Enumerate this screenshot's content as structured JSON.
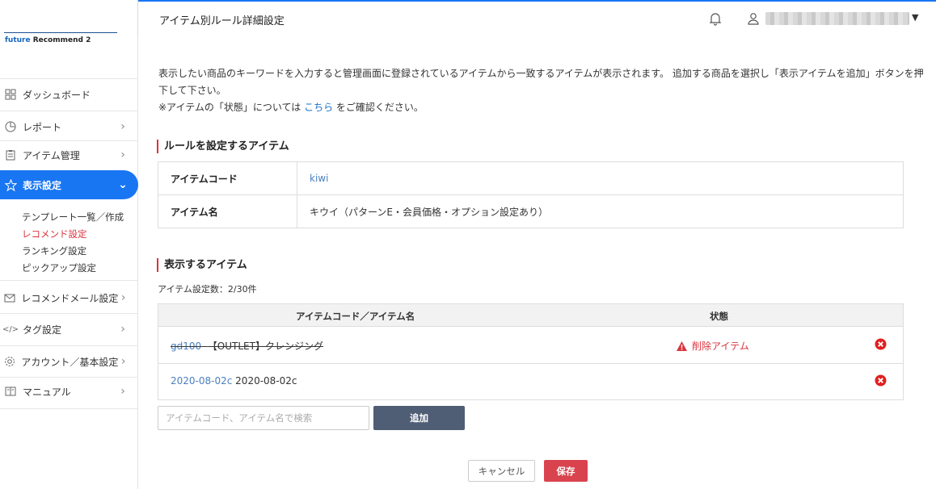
{
  "brand": {
    "future": "future",
    "rest": " Recommend 2"
  },
  "sidebar": {
    "items": [
      {
        "label": "ダッシュボード",
        "icon": "dashboard-icon"
      },
      {
        "label": "レポート",
        "icon": "chart-icon"
      },
      {
        "label": "アイテム管理",
        "icon": "clipboard-icon"
      },
      {
        "label": "表示設定",
        "icon": "star-icon"
      },
      {
        "label": "レコメンドメール設定",
        "icon": "mail-icon"
      },
      {
        "label": "タグ設定",
        "icon": "code-icon"
      },
      {
        "label": "アカウント／基本設定",
        "icon": "gear-icon"
      },
      {
        "label": "マニュアル",
        "icon": "book-icon"
      }
    ],
    "sub_items": [
      "テンプレート一覧／作成",
      "レコメンド設定",
      "ランキング設定",
      "ピックアップ設定"
    ]
  },
  "header": {
    "title": "アイテム別ルール詳細設定"
  },
  "main": {
    "desc_line1": "表示したい商品のキーワードを入力すると管理画面に登録されているアイテムから一致するアイテムが表示されます。 追加する商品を選択し「表示アイテムを追加」ボタンを押",
    "desc_line2": "下して下さい。",
    "note_prefix": "※アイテムの「状態」については ",
    "note_link": "こちら",
    "note_suffix": " をご確認ください。",
    "rule_section_title": "ルールを設定するアイテム",
    "rule_item": {
      "code_label": "アイテムコード",
      "code_value": "kiwi",
      "name_label": "アイテム名",
      "name_value": "キウイ（パターンE・会員価格・オプション設定あり）"
    },
    "display_section_title": "表示するアイテム",
    "count_text": "アイテム設定数：2/30件",
    "table": {
      "headers": [
        "アイテムコード／アイテム名",
        "状態"
      ],
      "rows": [
        {
          "code": "gd100",
          "name": "【OUTLET】クレンジング",
          "status": "削除アイテム",
          "deleted": true
        },
        {
          "code": "2020-08-02c",
          "name": "2020-08-02c",
          "status": "",
          "deleted": false
        }
      ]
    },
    "search_placeholder": "アイテムコード、アイテム名で検索",
    "add_label": "追加",
    "cancel_label": "キャンセル",
    "save_label": "保存"
  },
  "colors": {
    "accent": "#1976f2",
    "danger": "#d9343e",
    "link": "#1a6fc7",
    "add_button": "#4f5d75"
  }
}
